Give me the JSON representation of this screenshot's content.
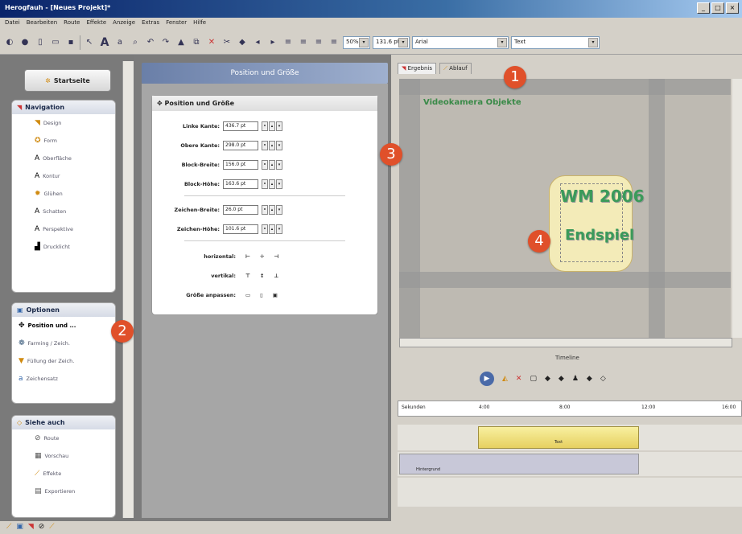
{
  "title": "Herogfauh - [Neues Projekt]*",
  "menu": [
    "Datei",
    "Bearbeiten",
    "Route",
    "Effekte",
    "Anzeige",
    "Extras",
    "Fenster",
    "Hilfe"
  ],
  "toolbar": {
    "zoom": "50%",
    "size": "131.6 pt",
    "font": "Arial",
    "text": "Text"
  },
  "start": {
    "label": "Startseite"
  },
  "nav": {
    "title": "Navigation",
    "items": [
      "Design",
      "Form",
      "Oberfläche",
      "Kontur",
      "Glühen",
      "Schatten",
      "Perspektive",
      "Drucklicht"
    ]
  },
  "options": {
    "title": "Optionen",
    "items": [
      "Position und ...",
      "Farming / Zeich.",
      "Füllung der Zeich.",
      "Zeichensatz"
    ]
  },
  "see": {
    "title": "Siehe auch",
    "items": [
      "Route",
      "Vorschau",
      "Effekte",
      "Exportieren"
    ]
  },
  "panel": {
    "header": "Position und Größe",
    "section": "Position und Größe",
    "fields": [
      {
        "label": "Linke Kante:",
        "value": "436.7 pt"
      },
      {
        "label": "Obere Kante:",
        "value": "298.0 pt"
      },
      {
        "label": "Block-Breite:",
        "value": "156.0 pt"
      },
      {
        "label": "Block-Höhe:",
        "value": "163.6 pt"
      }
    ],
    "fields2": [
      {
        "label": "Zeichen-Breite:",
        "value": "26.0 pt"
      },
      {
        "label": "Zeichen-Höhe:",
        "value": "101.6 pt"
      }
    ],
    "horizontal": "horizontal:",
    "vertical": "vertikal:",
    "fit": "Größe anpassen:"
  },
  "tabs": [
    "Ergebnis",
    "Ablauf"
  ],
  "preview": {
    "watermark": "Videokamera Objekte",
    "line1": "WM 2006",
    "line2": "Endspiel"
  },
  "timeline": {
    "label": "Timeline",
    "ruler": [
      "Sekunden",
      "4:00",
      "8:00",
      "12:00",
      "16:00"
    ],
    "clip": "Text",
    "clip2": "Hintergrund"
  },
  "markers": [
    "1",
    "2",
    "3",
    "4"
  ]
}
